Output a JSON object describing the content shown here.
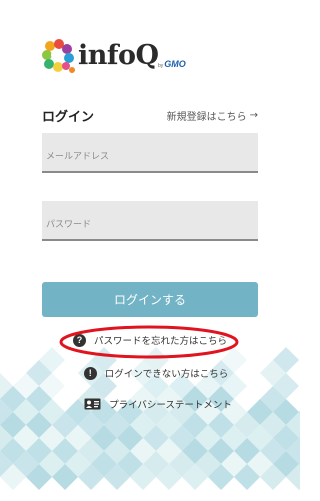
{
  "logo": {
    "brand": "infoQ",
    "by_prefix": "by",
    "by_company": "GMO",
    "icon": "infoq-logo-mark"
  },
  "login": {
    "heading": "ログイン",
    "register_link": "新規登録はこちら",
    "register_arrow": "→"
  },
  "form": {
    "email_placeholder": "メールアドレス",
    "email_value": "",
    "password_placeholder": "パスワード",
    "password_value": "",
    "submit_label": "ログインする"
  },
  "links": {
    "forgot_password": "パスワードを忘れた方はこちら",
    "forgot_icon": "question-circle-icon",
    "cannot_login": "ログインできない方はこちら",
    "cannot_icon": "exclamation-circle-icon",
    "privacy": "プライバシーステートメント",
    "privacy_icon": "id-card-icon"
  },
  "colors": {
    "button": "#72b3c6",
    "annotation": "#e0141e",
    "field_bg": "#e8e8e8"
  }
}
